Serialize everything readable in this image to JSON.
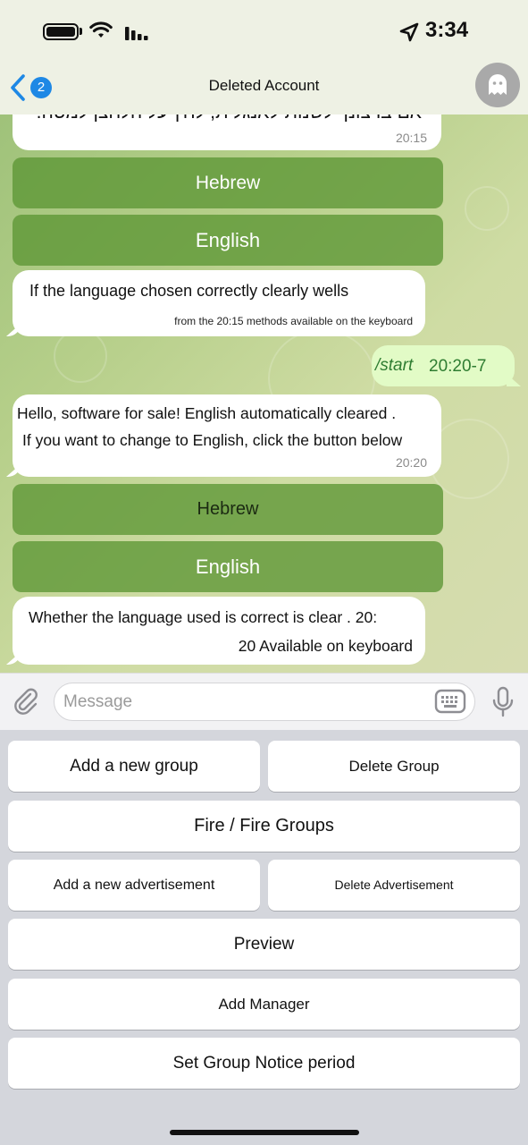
{
  "status_bar": {
    "time": "3:34"
  },
  "nav": {
    "back_badge": "2",
    "title": "Deleted Account"
  },
  "chat": {
    "messages": [
      {
        "text": "אם ברצונך לשנות לאנגלית, לחץ על הלחצן למטה.",
        "time": "20:15"
      },
      {
        "text": "If the language chosen correctly clearly wells",
        "subtext": "from the 20:15 methods available on the keyboard"
      },
      {
        "text": "/start",
        "time": "20:20-7"
      },
      {
        "line1": "Hello, software for sale! English automatically cleared .",
        "line2": "If you want to change to English, click the button below",
        "time": "20:20"
      },
      {
        "line1": "Whether the language used is correct is clear . 20:",
        "line2": "20 Available on keyboard"
      }
    ],
    "inline_buttons_1": [
      "Hebrew",
      "English"
    ],
    "inline_buttons_2": [
      "Hebrew",
      "English"
    ]
  },
  "input": {
    "placeholder": "Message"
  },
  "keyboard": {
    "add_group": "Add a new group",
    "delete_group": "Delete Group",
    "fire_groups": "Fire / Fire Groups",
    "add_ad": "Add a new advertisement",
    "delete_ad": "Delete Advertisement",
    "preview": "Preview",
    "add_manager": "Add Manager",
    "notice_period": "Set Group Notice period"
  },
  "colors": {
    "accent": "#1e88e5",
    "inline_button": "#5c9634",
    "outgoing_bubble": "#e2fbc6"
  }
}
